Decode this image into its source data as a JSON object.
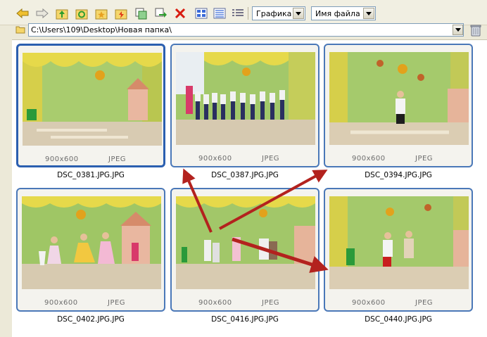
{
  "toolbar": {
    "view_mode": "Графика",
    "sort_by": "Имя файла",
    "icons": [
      "back-arrow-icon",
      "forward-arrow-icon",
      "up-folder-icon",
      "refresh-icon",
      "new-folder-icon",
      "favorites-icon",
      "copy-icon",
      "move-icon",
      "delete-icon",
      "view-thumbnails-icon",
      "view-list-icon",
      "view-details-icon"
    ]
  },
  "address": {
    "path": "C:\\Users\\109\\Desktop\\Новая папка\\"
  },
  "items": [
    {
      "name": "DSC_0381.JPG.JPG",
      "dims": "900x600",
      "format": "JPEG",
      "selected": true
    },
    {
      "name": "DSC_0387.JPG.JPG",
      "dims": "900x600",
      "format": "JPEG",
      "selected": false
    },
    {
      "name": "DSC_0394.JPG.JPG",
      "dims": "900x600",
      "format": "JPEG",
      "selected": false
    },
    {
      "name": "DSC_0402.JPG.JPG",
      "dims": "900x600",
      "format": "JPEG",
      "selected": false
    },
    {
      "name": "DSC_0416.JPG.JPG",
      "dims": "900x600",
      "format": "JPEG",
      "selected": false
    },
    {
      "name": "DSC_0440.JPG.JPG",
      "dims": "900x600",
      "format": "JPEG",
      "selected": false
    }
  ],
  "colors": {
    "selection_border": "#2b5fb0",
    "tile_border": "#4a78b8",
    "annotation_arrow": "#b3221e"
  }
}
